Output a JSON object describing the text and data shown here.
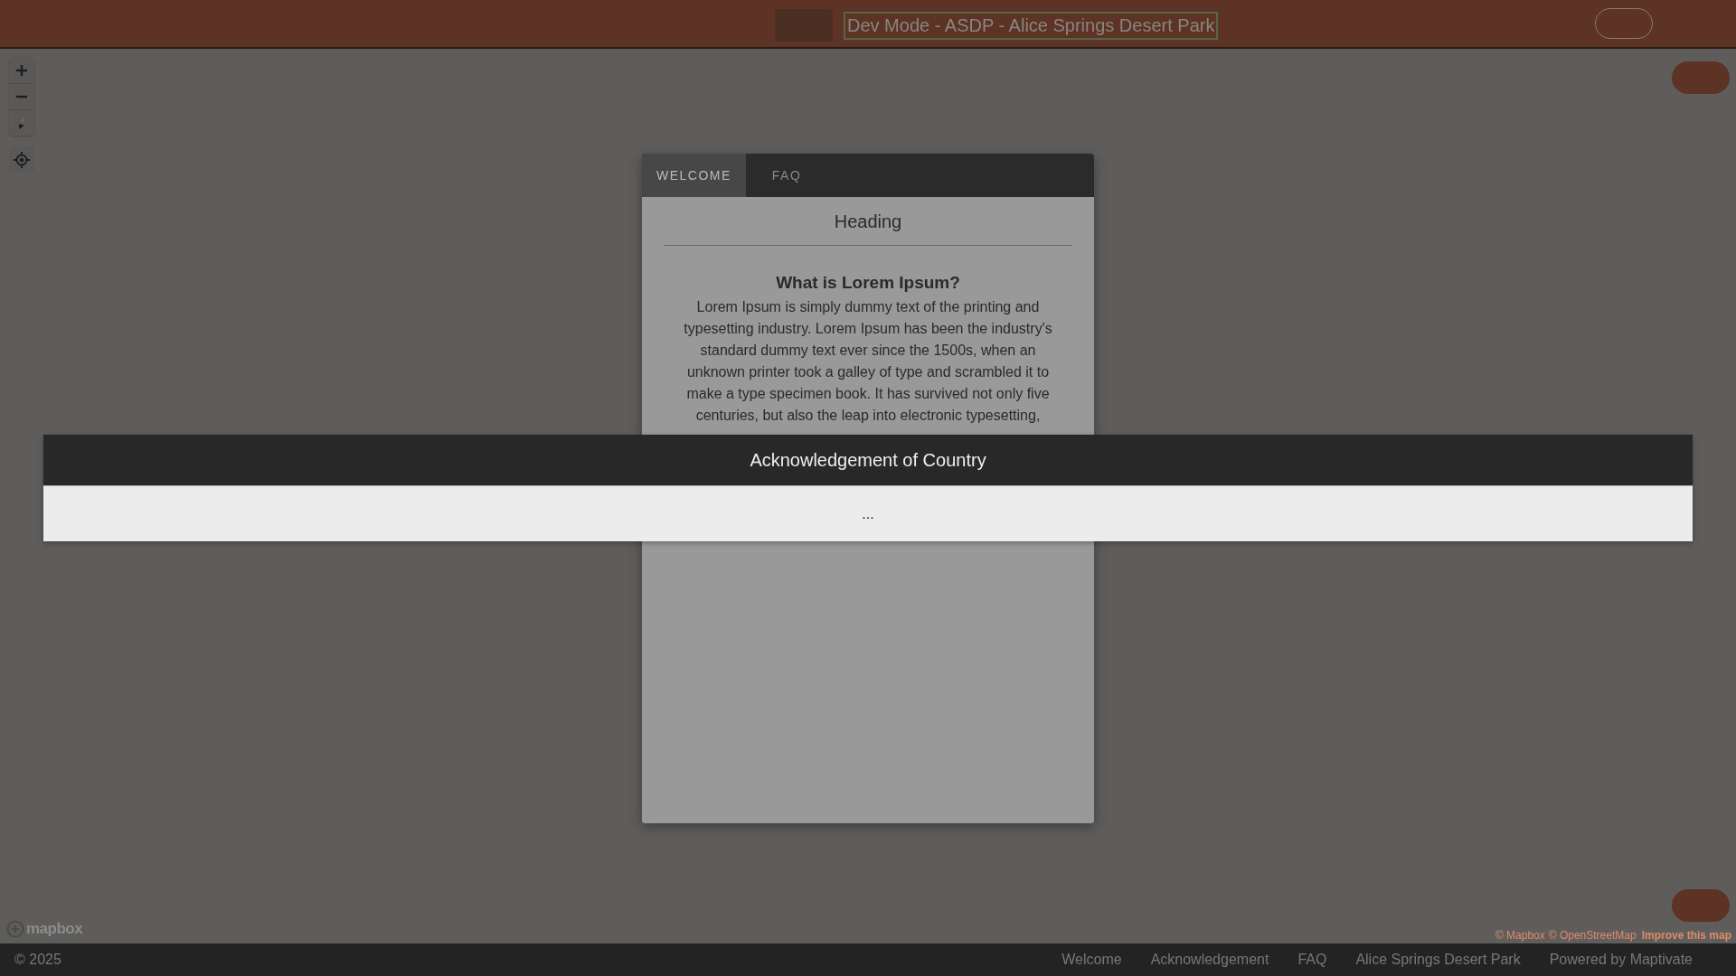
{
  "top_bar": {
    "title": "Dev Mode - ASDP - Alice Springs Desert Park"
  },
  "dialog": {
    "tabs": [
      {
        "label": "WELCOME",
        "selected": true
      },
      {
        "label": "FAQ",
        "selected": false
      }
    ],
    "heading": "Heading",
    "subheading": "What is Lorem Ipsum?",
    "body": "Lorem Ipsum is simply dummy text of the printing and typesetting industry. Lorem Ipsum has been the industry's standard dummy text ever since the 1500s, when an unknown printer took a galley of type and scrambled it to make a type specimen book. It has survived not only five centuries, but also the leap into electronic typesetting,"
  },
  "banner": {
    "title": "Acknowledgement of Country",
    "body": "..."
  },
  "map_logo": "mapbox",
  "attribution": [
    {
      "label": "© Mapbox",
      "kind": "link"
    },
    {
      "label": "© OpenStreetMap",
      "kind": "link"
    },
    {
      "label": "Improve this map",
      "kind": "strong"
    }
  ],
  "footer": {
    "copyright": "© 2025",
    "links": [
      "Welcome",
      "Acknowledgement",
      "FAQ",
      "Alice Springs Desert Park",
      "Powered by Maptivate"
    ]
  }
}
